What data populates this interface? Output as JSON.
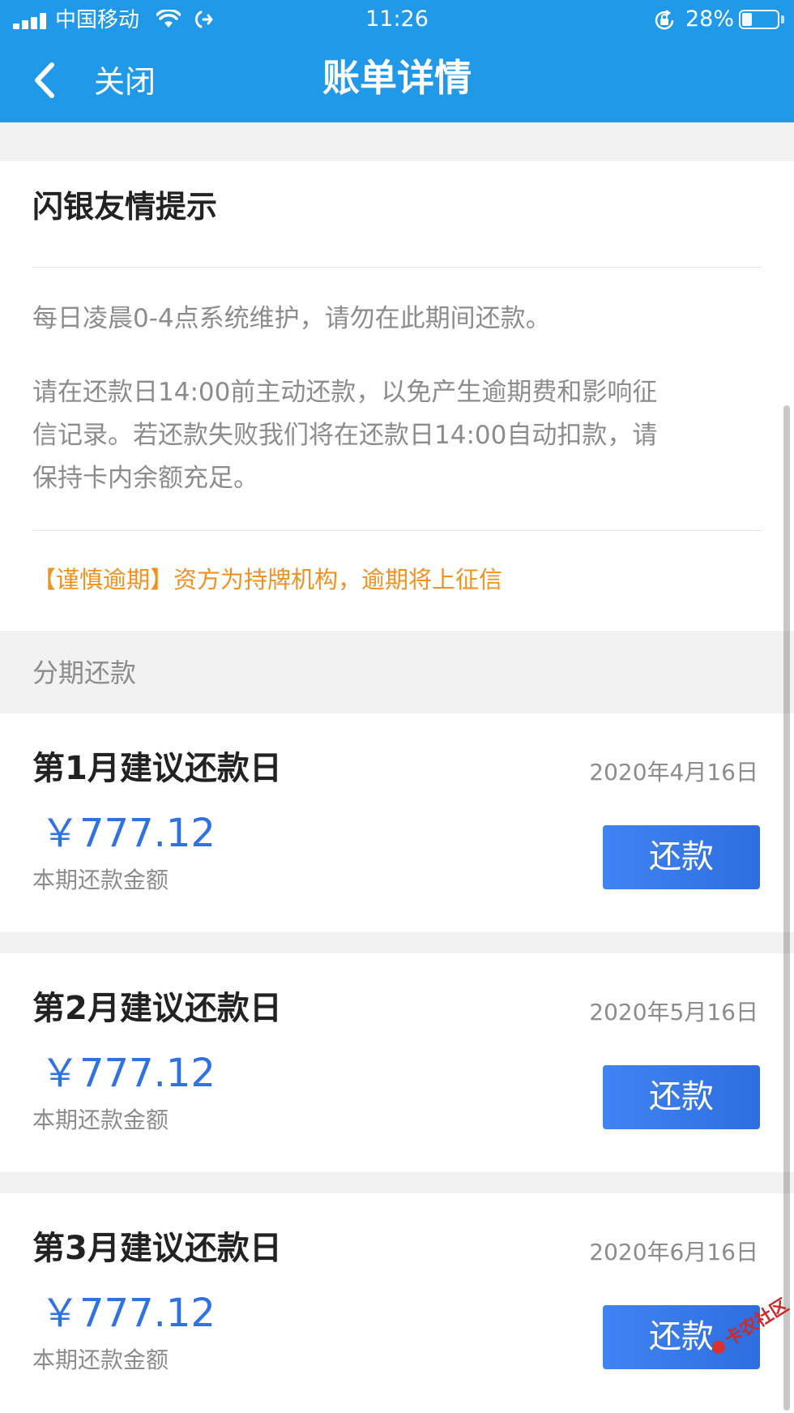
{
  "status_bar": {
    "carrier": "中国移动",
    "time": "11:26",
    "battery_percent": "28%",
    "battery_level": 0.28
  },
  "nav": {
    "back_label": "关闭",
    "title": "账单详情"
  },
  "tip": {
    "title": "闪银友情提示",
    "lines": [
      "每日凌晨0-4点系统维护，请勿在此期间还款。",
      "请在还款日14:00前主动还款，以免产生逾期费和影响征",
      "信记录。若还款失败我们将在还款日14:00自动扣款，请",
      "保持卡内余额充足。"
    ],
    "warning": "【谨慎逾期】资方为持牌机构，逾期将上征信",
    "warning_color": "#f29120"
  },
  "section": {
    "label": "分期还款"
  },
  "installments": [
    {
      "title": "第1月建议还款日",
      "date": "2020年4月16日",
      "amount": "￥777.12",
      "caption": "本期还款金额",
      "button": "还款"
    },
    {
      "title": "第2月建议还款日",
      "date": "2020年5月16日",
      "amount": "￥777.12",
      "caption": "本期还款金额",
      "button": "还款"
    },
    {
      "title": "第3月建议还款日",
      "date": "2020年6月16日",
      "amount": "￥777.12",
      "caption": "本期还款金额",
      "button": "还款"
    }
  ],
  "colors": {
    "header": "#1f99e8",
    "amount": "#2f72e4",
    "button": "#3478ea"
  },
  "watermark": {
    "text": "卡农社区"
  }
}
